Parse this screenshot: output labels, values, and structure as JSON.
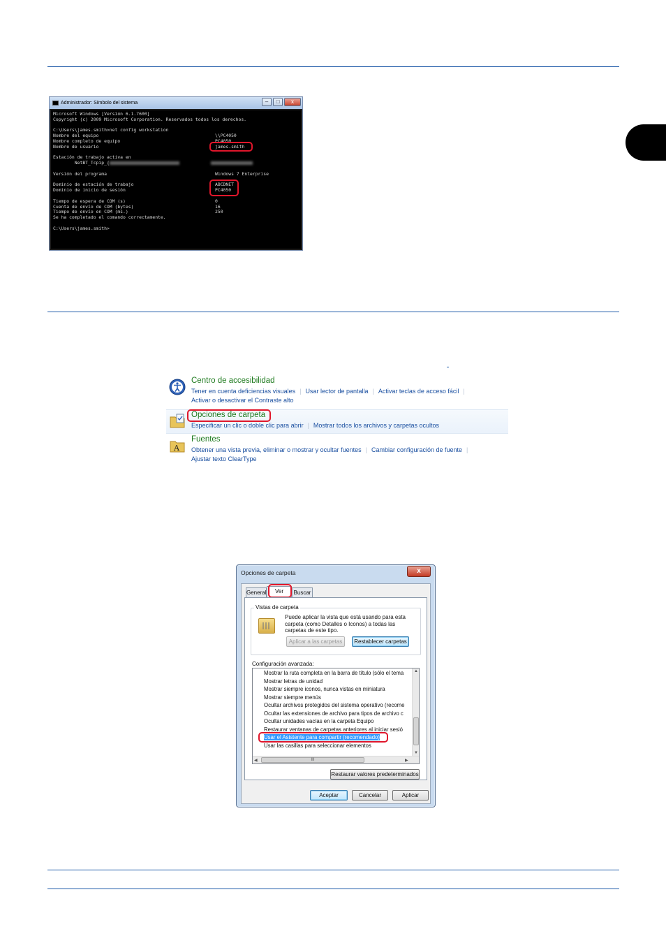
{
  "cmd": {
    "title": "Administrador: Símbolo del sistema",
    "lines": [
      {
        "l": "Microsoft Windows [Versión 6.1.7600]",
        "r": ""
      },
      {
        "l": "Copyright (c) 2009 Microsoft Corporation. Reservados todos los derechos.",
        "r": ""
      },
      {
        "l": "",
        "r": ""
      },
      {
        "l": "C:\\Users\\james.smith>net config workstation",
        "r": ""
      },
      {
        "l": "Nombre del equipo",
        "r": "\\\\PC4050"
      },
      {
        "l": "Nombre completo de equipo",
        "r": "PC4050"
      },
      {
        "l": "Nombre de usuario",
        "r": "james.smith"
      },
      {
        "l": "",
        "r": ""
      },
      {
        "l": "Estación de trabajo activa en",
        "r": ""
      },
      {
        "l": "        NetBT_Tcpip_{",
        "r": ""
      },
      {
        "l": "",
        "r": ""
      },
      {
        "l": "Versión del programa",
        "r": "Windows 7 Enterprise"
      },
      {
        "l": "",
        "r": ""
      },
      {
        "l": "Dominio de estación de trabajo",
        "r": "ABCDNET"
      },
      {
        "l": "Dominio de inicio de sesión",
        "r": "PC4050"
      },
      {
        "l": "",
        "r": ""
      },
      {
        "l": "Tiempo de espera de COM (s)",
        "r": "0"
      },
      {
        "l": "Cuenta de envío de COM (bytes)",
        "r": "16"
      },
      {
        "l": "Tiempo de envío en COM (ms.)",
        "r": "250"
      },
      {
        "l": "Se ha completado el comando correctamente.",
        "r": ""
      },
      {
        "l": "",
        "r": ""
      },
      {
        "l": "C:\\Users\\james.smith>",
        "r": ""
      }
    ]
  },
  "control_panel": {
    "items": [
      {
        "title": "Centro de accesibilidad",
        "links": [
          "Tener en cuenta deficiencias visuales",
          "Usar lector de pantalla",
          "Activar teclas de acceso fácil",
          "Activar o desactivar el Contraste alto"
        ]
      },
      {
        "title": "Opciones de carpeta",
        "links": [
          "Especificar un clic o doble clic para abrir",
          "Mostrar todos los archivos y carpetas ocultos"
        ]
      },
      {
        "title": "Fuentes",
        "links": [
          "Obtener una vista previa, eliminar o mostrar y ocultar fuentes",
          "Cambiar configuración de fuente",
          "Ajustar texto ClearType"
        ]
      }
    ]
  },
  "dialog": {
    "title": "Opciones de carpeta",
    "close_glyph": "x",
    "tabs": [
      "General",
      "Ver",
      "Buscar"
    ],
    "views_group_label": "Vistas de carpeta",
    "views_text": "Puede aplicar la vista que está usando para esta carpeta (como Detalles o Iconos) a todas las carpetas de este tipo.",
    "apply_folders": "Aplicar a las carpetas",
    "reset_folders": "Restablecer carpetas",
    "advanced_label": "Configuración avanzada:",
    "settings": [
      {
        "label": "Mostrar la ruta completa en la barra de título (sólo el tema",
        "checked": false
      },
      {
        "label": "Mostrar letras de unidad",
        "checked": true
      },
      {
        "label": "Mostrar siempre iconos, nunca vistas en miniatura",
        "checked": false
      },
      {
        "label": "Mostrar siempre menús",
        "checked": false
      },
      {
        "label": "Ocultar archivos protegidos del sistema operativo (recome",
        "checked": true
      },
      {
        "label": "Ocultar las extensiones de archivo para tipos de archivo c",
        "checked": true
      },
      {
        "label": "Ocultar unidades vacías en la carpeta Equipo",
        "checked": true
      },
      {
        "label": "Restaurar ventanas de carpetas anteriores al iniciar sesió",
        "checked": false
      },
      {
        "label": "Usar el Asistente para compartir (recomendado)",
        "checked": false,
        "selected": true
      },
      {
        "label": "Usar las casillas para seleccionar elementos",
        "checked": false
      }
    ],
    "scroll_grip": "III",
    "restore_defaults": "Restaurar valores predeterminados",
    "ok": "Aceptar",
    "cancel": "Cancelar",
    "apply": "Aplicar"
  }
}
